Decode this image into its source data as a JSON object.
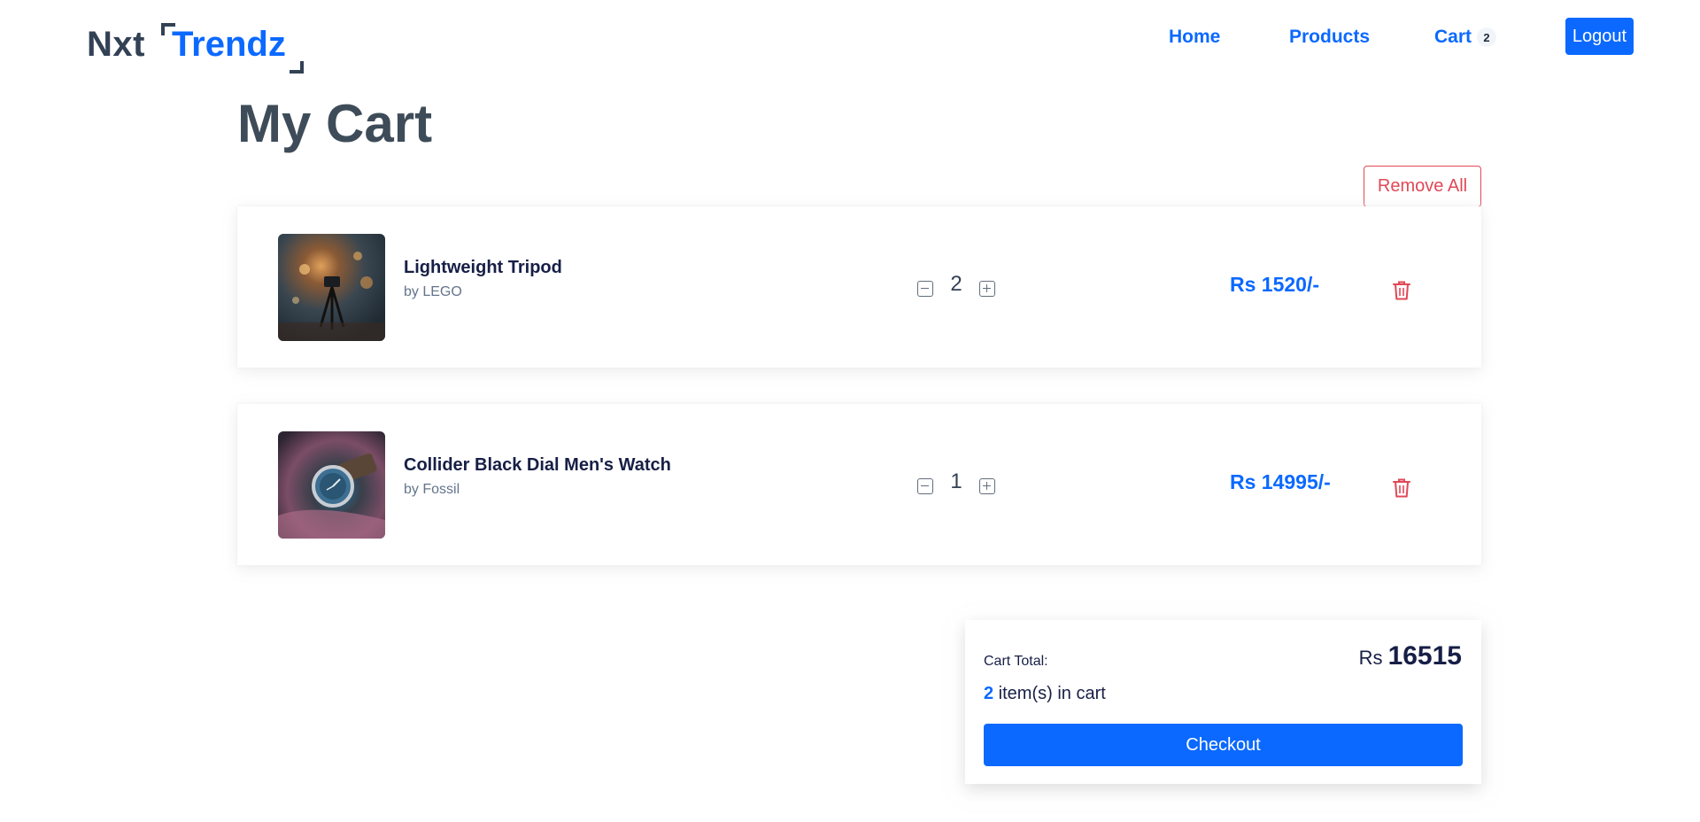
{
  "header": {
    "logo_part1": "Nxt",
    "logo_part2": "Trendz",
    "nav": {
      "home": "Home",
      "products": "Products",
      "cart": "Cart",
      "cart_count": "2"
    },
    "logout_label": "Logout"
  },
  "page": {
    "title": "My Cart",
    "remove_all_label": "Remove All"
  },
  "cart_items": [
    {
      "title": "Lightweight Tripod",
      "brand": "by LEGO",
      "quantity": "2",
      "price": "Rs 1520/-",
      "image_icon": "tripod-image"
    },
    {
      "title": "Collider Black Dial Men's Watch",
      "brand": "by Fossil",
      "quantity": "1",
      "price": "Rs 14995/-",
      "image_icon": "watch-image"
    }
  ],
  "summary": {
    "label": "Cart Total:",
    "currency": "Rs",
    "amount": "16515",
    "item_count": "2",
    "item_count_suffix": " item(s) in cart",
    "checkout_label": "Checkout"
  },
  "colors": {
    "accent": "#0b69ff",
    "danger": "#e04856",
    "heading": "#3e4c59",
    "logo_dark": "#334155"
  },
  "icons": {
    "delete": "trash-icon",
    "decrement": "minus-square-icon",
    "increment": "plus-square-icon"
  }
}
